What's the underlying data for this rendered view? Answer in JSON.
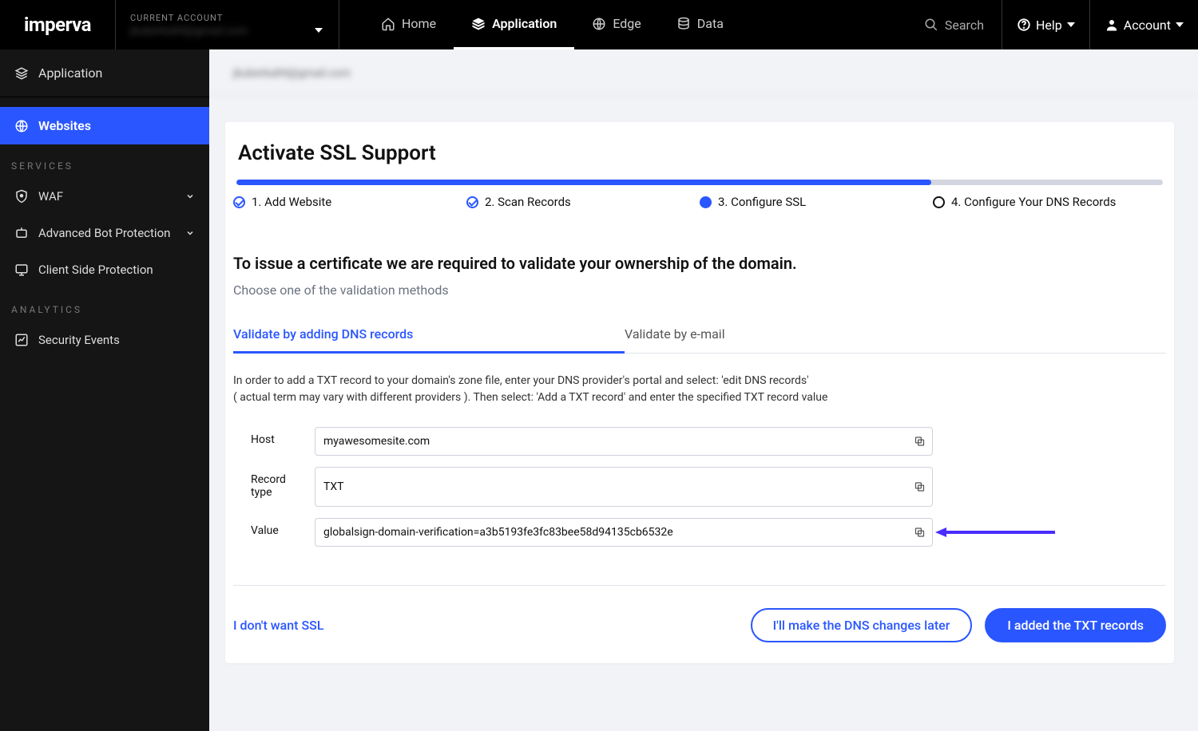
{
  "brand": "imperva",
  "accountSelector": {
    "label": "CURRENT ACCOUNT",
    "value": "jkuberka84@gmail.com"
  },
  "nav": {
    "home": "Home",
    "application": "Application",
    "edge": "Edge",
    "data": "Data",
    "search": "Search",
    "help": "Help",
    "account": "Account"
  },
  "sidebar": {
    "header": "Application",
    "websites": "Websites",
    "sections": {
      "services": "SERVICES",
      "analytics": "ANALYTICS"
    },
    "items": {
      "waf": "WAF",
      "abp": "Advanced Bot Protection",
      "csp": "Client Side Protection",
      "security_events": "Security Events"
    }
  },
  "breadcrumb": "jkuberka84@gmail.com",
  "page": {
    "title": "Activate SSL Support",
    "steps": {
      "s1": "1. Add Website",
      "s2": "2. Scan Records",
      "s3": "3. Configure SSL",
      "s4": "4. Configure Your DNS Records"
    },
    "heading": "To issue a certificate we are required to validate your ownership of the domain.",
    "subheading": "Choose one of the validation methods",
    "tabs": {
      "dns": "Validate by adding DNS records",
      "email": "Validate by e-mail"
    },
    "tab_desc_l1": "In order to add a TXT record to your domain's zone file, enter your DNS provider's portal and select: 'edit DNS records'",
    "tab_desc_l2": "( actual term may vary with different providers ). Then select: 'Add a TXT record' and enter the specified TXT record value",
    "fields": {
      "host_label": "Host",
      "host_value": "myawesomesite.com",
      "type_label": "Record type",
      "type_value": "TXT",
      "value_label": "Value",
      "value_value": "globalsign-domain-verification=a3b5193fe3fc83bee58d94135cb6532e"
    },
    "footer": {
      "cancel": "I don't want SSL",
      "later": "I'll make the DNS changes later",
      "done": "I added the TXT records"
    }
  }
}
